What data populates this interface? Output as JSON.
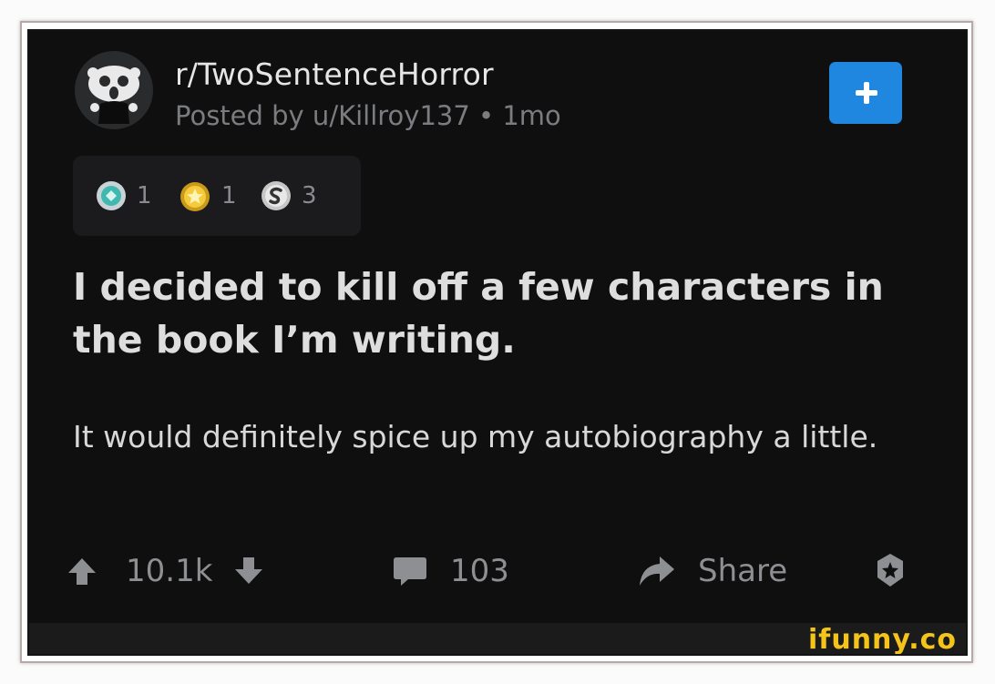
{
  "post": {
    "subreddit": "r/TwoSentenceHorror",
    "posted_by": "Posted by u/Killroy137 • 1mo",
    "title": "I decided to kill off a few characters in the book I’m writing.",
    "body": "It would definitely spice up my autobiography a little."
  },
  "awards": [
    {
      "icon": "helpful-award-icon",
      "count": "1"
    },
    {
      "icon": "gold-award-icon",
      "count": "1"
    },
    {
      "icon": "silver-award-icon",
      "count": "3"
    }
  ],
  "actions": {
    "score": "10.1k",
    "comments": "103",
    "share_label": "Share"
  },
  "watermark": "ifunny.co",
  "colors": {
    "background": "#0f0f10",
    "join_button": "#1f87e0",
    "muted_text": "#8e8f92",
    "watermark": "#f4c419"
  }
}
